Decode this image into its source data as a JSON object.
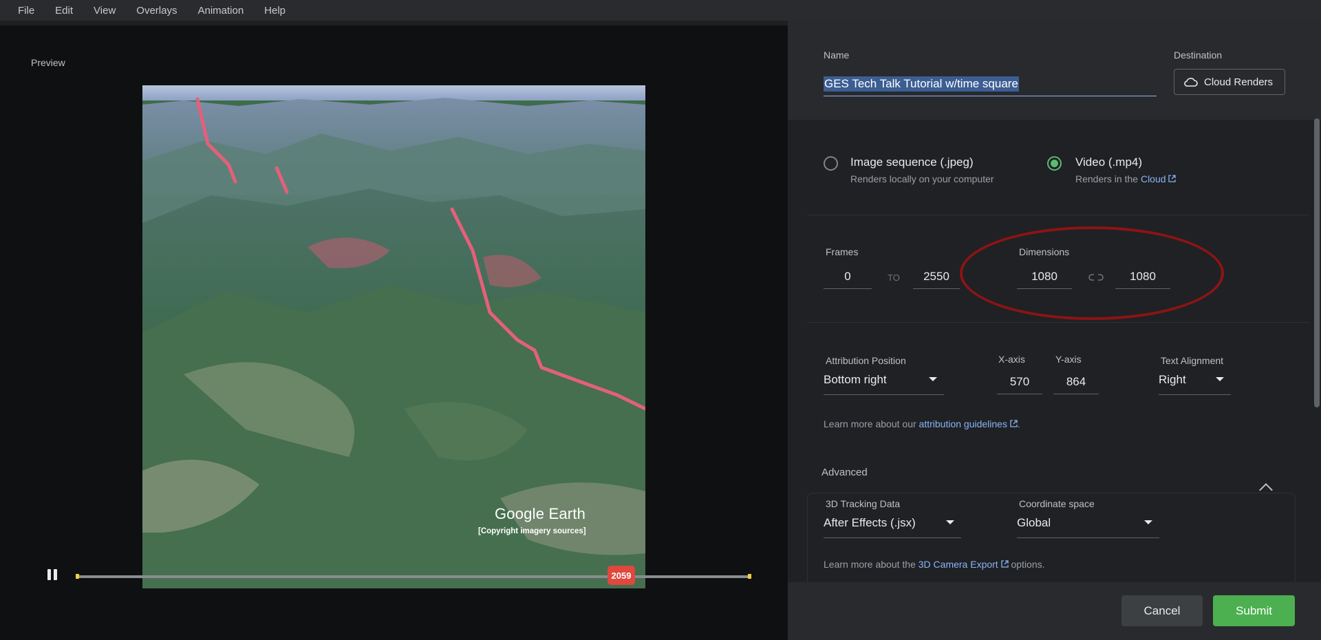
{
  "menu": [
    "File",
    "Edit",
    "View",
    "Overlays",
    "Animation",
    "Help"
  ],
  "preview": {
    "label": "Preview",
    "brand": "Google Earth",
    "copyright": "[Copyright imagery sources]",
    "current_frame": "2059",
    "colors": {
      "route": "#e4607a",
      "thumb": "#e0473d"
    }
  },
  "render": {
    "name_label": "Name",
    "name_value": "GES Tech Talk Tutorial w/time square",
    "destination_label": "Destination",
    "destination_value": "Cloud Renders",
    "destination_icon": "cloud-icon",
    "options": [
      {
        "title": "Image sequence (.jpeg)",
        "subtitle": "Renders locally on your computer",
        "selected": false
      },
      {
        "title": "Video (.mp4)",
        "subtitle_prefix": "Renders in the ",
        "subtitle_link": "Cloud",
        "selected": true
      }
    ],
    "frames": {
      "label": "Frames",
      "from": "0",
      "to_label": "TO",
      "to": "2550"
    },
    "dimensions": {
      "label": "Dimensions",
      "width": "1080",
      "link_icon": "link-icon",
      "height": "1080"
    },
    "attribution": {
      "position_label": "Attribution Position",
      "position_value": "Bottom right",
      "x_label": "X-axis",
      "x_value": "570",
      "y_label": "Y-axis",
      "y_value": "864",
      "align_label": "Text Alignment",
      "align_value": "Right",
      "help_prefix": "Learn more about our ",
      "help_link": "attribution guidelines",
      "help_suffix": "."
    },
    "advanced": {
      "label": "Advanced",
      "tracking_label": "3D Tracking Data",
      "tracking_value": "After Effects (.jsx)",
      "coord_label": "Coordinate space",
      "coord_value": "Global",
      "help_prefix": "Learn more about the ",
      "help_link": "3D Camera Export",
      "help_suffix": " options."
    },
    "buttons": {
      "cancel": "Cancel",
      "submit": "Submit"
    },
    "accent_color": "#5bb974",
    "annotation_color": "#8c1414"
  }
}
